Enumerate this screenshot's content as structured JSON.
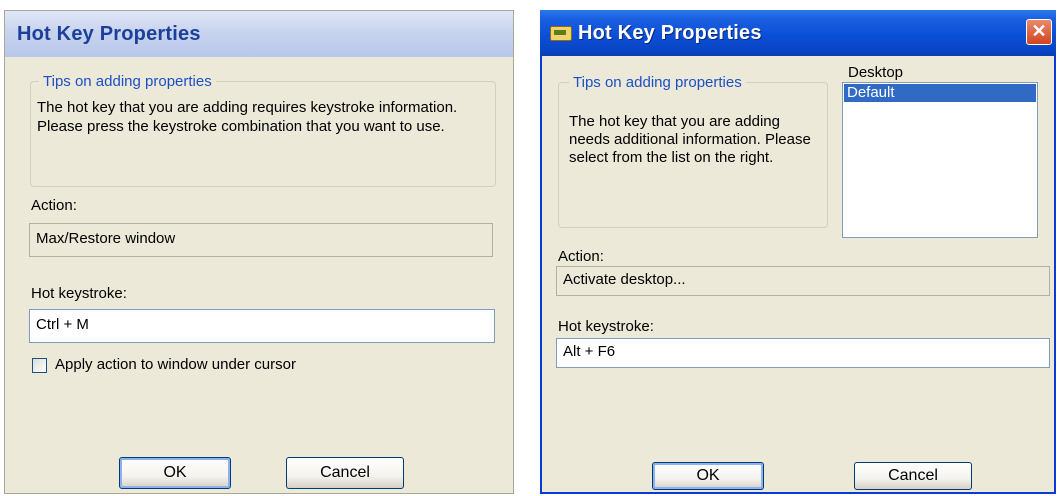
{
  "left_dialog": {
    "title": "Hot Key Properties",
    "tips_legend": "Tips on adding properties",
    "tips_text": "The hot key that you are adding requires keystroke information. Please press the keystroke combination that you want to use.",
    "action_label": "Action:",
    "action_value": "Max/Restore window",
    "hotkey_label": "Hot keystroke:",
    "hotkey_value": "Ctrl + M",
    "checkbox_label": "Apply action to window under cursor",
    "ok_label": "OK",
    "cancel_label": "Cancel"
  },
  "right_dialog": {
    "title": "Hot Key Properties",
    "close_label": "✕",
    "tips_legend": "Tips on adding properties",
    "tips_text": "The hot key that you are adding needs additional information. Please select from the list on the right.",
    "desktop_label": "Desktop",
    "desktop_items": [
      "Default"
    ],
    "action_label": "Action:",
    "action_value": "Activate desktop...",
    "hotkey_label": "Hot keystroke:",
    "hotkey_value": "Alt + F6",
    "ok_label": "OK",
    "cancel_label": "Cancel"
  },
  "colors": {
    "dialog_bg": "#ece9d8",
    "titlebar_active": "#0a46c6",
    "titlebar_inactive": "#c8d3ee",
    "legend_blue": "#1c4fc6",
    "selection": "#316ac5"
  },
  "icons": {
    "app": "app-icon",
    "close": "close-icon"
  }
}
